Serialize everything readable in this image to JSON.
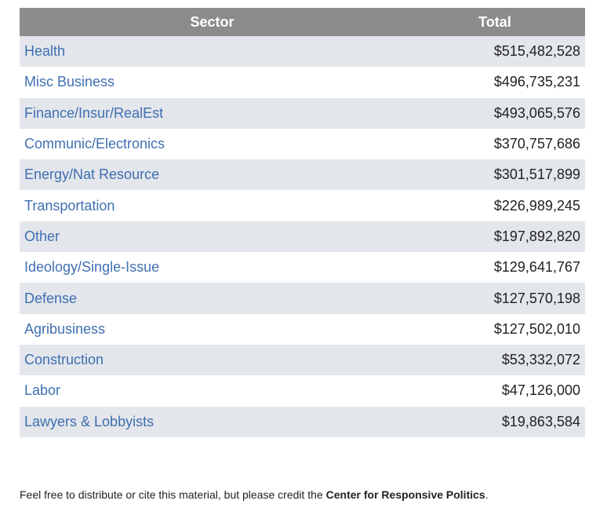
{
  "table": {
    "headers": {
      "sector": "Sector",
      "total": "Total"
    },
    "rows": [
      {
        "sector": "Health",
        "total": "$515,482,528"
      },
      {
        "sector": "Misc Business",
        "total": "$496,735,231"
      },
      {
        "sector": "Finance/Insur/RealEst",
        "total": "$493,065,576"
      },
      {
        "sector": "Communic/Electronics",
        "total": "$370,757,686"
      },
      {
        "sector": "Energy/Nat Resource",
        "total": "$301,517,899"
      },
      {
        "sector": "Transportation",
        "total": "$226,989,245"
      },
      {
        "sector": "Other",
        "total": "$197,892,820"
      },
      {
        "sector": "Ideology/Single-Issue",
        "total": "$129,641,767"
      },
      {
        "sector": "Defense",
        "total": "$127,570,198"
      },
      {
        "sector": "Agribusiness",
        "total": "$127,502,010"
      },
      {
        "sector": "Construction",
        "total": "$53,332,072"
      },
      {
        "sector": "Labor",
        "total": "$47,126,000"
      },
      {
        "sector": "Lawyers & Lobbyists",
        "total": "$19,863,584"
      }
    ]
  },
  "footer": {
    "prefix": "Feel free to distribute or cite this material, but please credit the ",
    "source": "Center for Responsive Politics",
    "suffix": "."
  }
}
